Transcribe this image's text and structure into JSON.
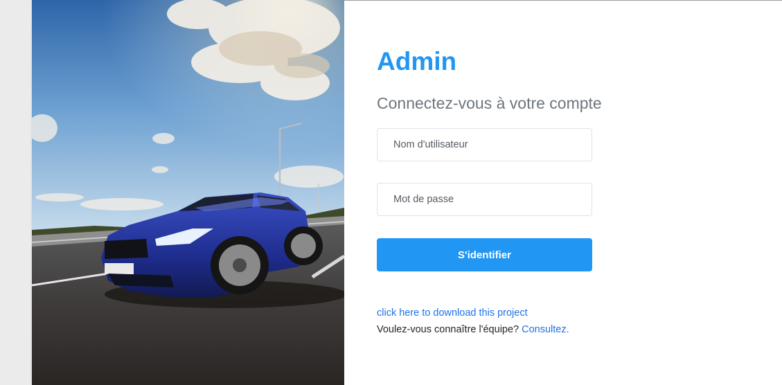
{
  "brand": {
    "title": "Admin"
  },
  "login": {
    "subtitle": "Connectez-vous à votre compte",
    "username_placeholder": "Nom d'utilisateur",
    "username_value": "",
    "password_placeholder": "Mot de passe",
    "password_value": "",
    "submit_label": "S'identifier"
  },
  "footer": {
    "download_link": "click here to download this project",
    "team_question": "Voulez-vous connaître l'équipe?",
    "team_link": "Consultez."
  },
  "colors": {
    "accent": "#2196f3",
    "link": "#1a73e8",
    "subtitle": "#6c757d"
  },
  "hero": {
    "subject": "blue-sports-car-photo"
  }
}
